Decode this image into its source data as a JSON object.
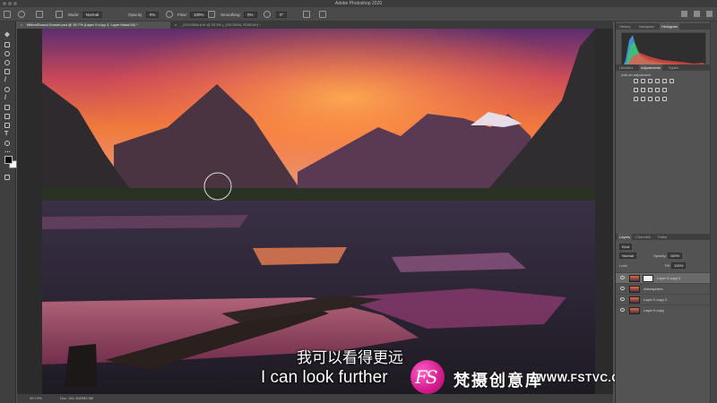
{
  "app": {
    "window_title": "Adobe Photoshop 2020"
  },
  "options_bar": {
    "mode_label": "Mode:",
    "mode_value": "Normal",
    "opacity_label": "Opacity:",
    "opacity_value": "0%",
    "flow_label": "Flow:",
    "flow_value": "100%",
    "smoothing_label": "Smoothing:",
    "smoothing_value": "0%",
    "angle_value": "0°"
  },
  "tabs": [
    {
      "label": "MilfordSound-Sunset.psd @ 39.7% (Layer 0 copy 3, Layer Mask/16) *"
    },
    {
      "label": "_DSC0598-6.tif @ 33.3% (_DSC0598, RGB/16*) *"
    }
  ],
  "tools": [
    "move-tool-icon",
    "marquee-tool-icon",
    "lasso-tool-icon",
    "quick-select-tool-icon",
    "crop-tool-icon",
    "frame-tool-icon",
    "eyedropper-tool-icon",
    "healing-brush-icon",
    "brush-tool-icon",
    "clone-stamp-icon",
    "history-brush-icon",
    "eraser-tool-icon",
    "gradient-tool-icon",
    "blur-tool-icon",
    "dodge-tool-icon",
    "pen-tool-icon",
    "type-tool-icon",
    "path-select-icon",
    "shape-tool-icon",
    "hand-tool-icon",
    "zoom-tool-icon",
    "more-tools-icon"
  ],
  "colors": {
    "foreground": "#0a0a0a",
    "background": "#f5f5f5",
    "watermark_pink": "#d11b8a"
  },
  "subtitles": {
    "chinese": "我可以看得更远",
    "english": "I can look further"
  },
  "watermark": {
    "logo_text": "FS",
    "brand_cn": "梵摄创意库",
    "url": "WWW.FSTVC.CC"
  },
  "status_bar": {
    "zoom": "39.74%",
    "doc_info": "Doc: 341.3M/983.9M"
  },
  "panels": {
    "top_tabs": [
      "History",
      "Navigator",
      "Histogram"
    ],
    "top_active": "Histogram",
    "mid_tabs": [
      "Libraries",
      "Adjustments",
      "Styles"
    ],
    "mid_active": "Adjustments",
    "adjustments_prompt": "Add an adjustment",
    "layer_tabs": [
      "Layers",
      "Channels",
      "Paths"
    ],
    "layer_active": "Layers",
    "kind_filter": "Kind",
    "blend_mode": "Normal",
    "opacity_label": "Opacity:",
    "opacity_value": "100%",
    "lock_label": "Lock:",
    "fill_label": "Fill:",
    "fill_value": "100%"
  },
  "layers": [
    {
      "name": "Layer 0 copy 3",
      "selected": true,
      "has_mask": true
    },
    {
      "name": "Atmosphere",
      "selected": false,
      "has_mask": false
    },
    {
      "name": "Layer 0 copy 2",
      "selected": false,
      "has_mask": false
    },
    {
      "name": "Layer 0 copy",
      "selected": false,
      "has_mask": false
    }
  ]
}
